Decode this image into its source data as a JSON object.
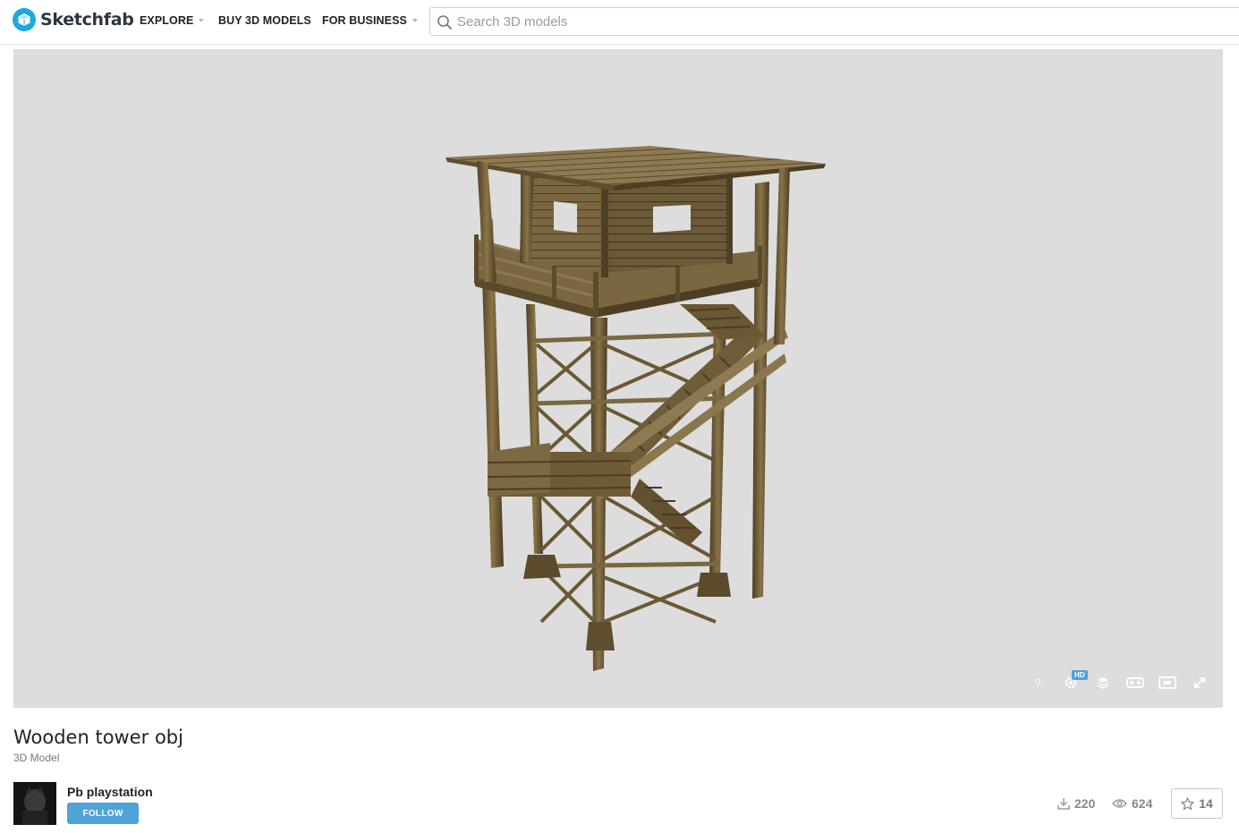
{
  "brand": {
    "name": "Sketchfab"
  },
  "nav": {
    "explore": "EXPLORE",
    "buy": "BUY 3D MODELS",
    "business": "FOR BUSINESS"
  },
  "search": {
    "placeholder": "Search 3D models",
    "value": ""
  },
  "viewer": {
    "controls": [
      "help-icon",
      "settings-icon",
      "layers-icon",
      "vr-icon",
      "display-icon",
      "fullscreen-icon"
    ],
    "hd_badge": "HD",
    "background": "#dddddd"
  },
  "model": {
    "title": "Wooden tower obj",
    "type": "3D Model"
  },
  "author": {
    "name": "Pb playstation",
    "follow_label": "FOLLOW"
  },
  "stats": {
    "downloads": "220",
    "views": "624",
    "likes": "14"
  },
  "colors": {
    "accent": "#4fa3d8",
    "brand": "#1caad9"
  }
}
